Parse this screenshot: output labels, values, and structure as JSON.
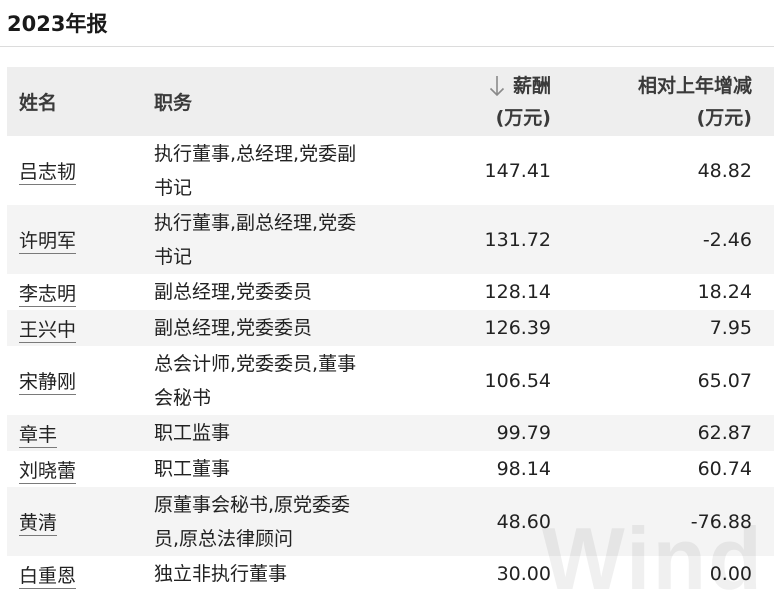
{
  "title": "2023年报",
  "table": {
    "headers": {
      "name": "姓名",
      "role": "职务",
      "pay_line1": "薪酬",
      "pay_line2": "(万元)",
      "delta_line1": "相对上年增减",
      "delta_line2": "(万元)"
    },
    "sort_icon": "arrow-down-icon",
    "rows": [
      {
        "name": "吕志韧",
        "role": "执行董事,总经理,党委副书记",
        "pay": "147.41",
        "delta": "48.82"
      },
      {
        "name": "许明军",
        "role": "执行董事,副总经理,党委书记",
        "pay": "131.72",
        "delta": "-2.46"
      },
      {
        "name": "李志明",
        "role": "副总经理,党委委员",
        "pay": "128.14",
        "delta": "18.24"
      },
      {
        "name": "王兴中",
        "role": "副总经理,党委委员",
        "pay": "126.39",
        "delta": "7.95"
      },
      {
        "name": "宋静刚",
        "role": "总会计师,党委委员,董事会秘书",
        "pay": "106.54",
        "delta": "65.07"
      },
      {
        "name": "章丰",
        "role": "职工监事",
        "pay": "99.79",
        "delta": "62.87"
      },
      {
        "name": "刘晓蕾",
        "role": "职工董事",
        "pay": "98.14",
        "delta": "60.74"
      },
      {
        "name": "黄清",
        "role": "原董事会秘书,原党委委员,原总法律顾问",
        "pay": "48.60",
        "delta": "-76.88"
      },
      {
        "name": "白重恩",
        "role": "独立非执行董事",
        "pay": "30.00",
        "delta": "0.00"
      }
    ]
  },
  "watermark": "Wind"
}
